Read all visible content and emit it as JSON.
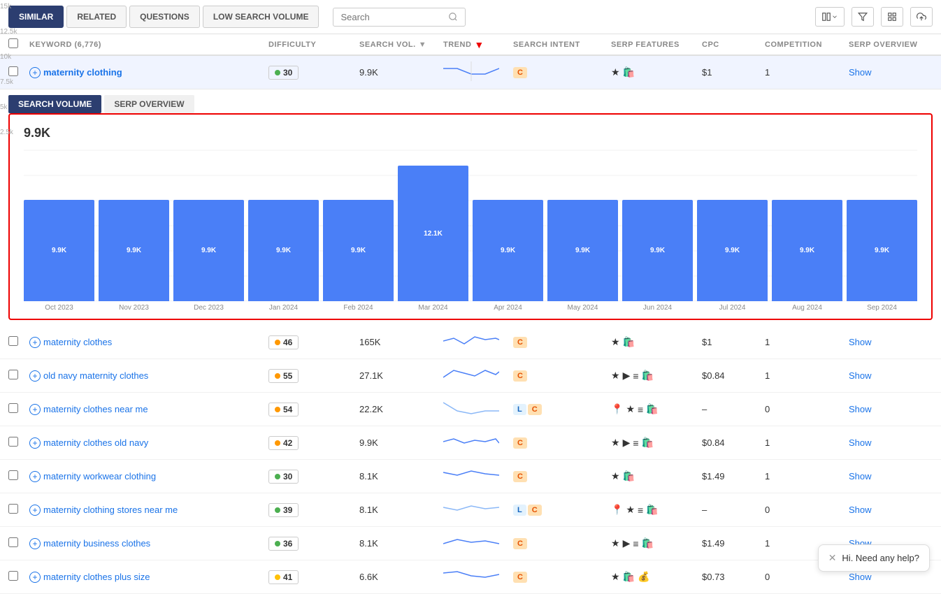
{
  "tabs": [
    {
      "id": "similar",
      "label": "SIMILAR",
      "active": true
    },
    {
      "id": "related",
      "label": "RELATED",
      "active": false
    },
    {
      "id": "questions",
      "label": "QUESTIONS",
      "active": false
    },
    {
      "id": "low_search_volume",
      "label": "LOW SEARCH VOLUME",
      "active": false
    }
  ],
  "search": {
    "placeholder": "Search"
  },
  "subtabs": [
    {
      "id": "search_volume",
      "label": "SEARCH VOLUME",
      "active": true
    },
    {
      "id": "serp_overview",
      "label": "SERP OVERVIEW",
      "active": false
    }
  ],
  "table": {
    "columns": {
      "keyword": "KEYWORD (6,776)",
      "difficulty": "DIFFICULTY",
      "search_vol": "SEARCH VOL.",
      "trend": "TREND",
      "search_intent": "SEARCH INTENT",
      "serp_features": "SERP FEATURES",
      "cpc": "CPC",
      "competition": "COMPETITION",
      "serp_overview": "SERP OVERVIEW"
    }
  },
  "main_keyword": {
    "name": "maternity clothing",
    "difficulty": 30,
    "diff_dot": "green",
    "search_vol": "9.9K",
    "intent": "C",
    "cpc": "$1",
    "competition": "1",
    "serp_overview": "Show"
  },
  "chart": {
    "title": "9.9K",
    "bars": [
      {
        "month": "Oct 2023",
        "value": "9.9K",
        "height_pct": 66
      },
      {
        "month": "Nov 2023",
        "value": "9.9K",
        "height_pct": 66
      },
      {
        "month": "Dec 2023",
        "value": "9.9K",
        "height_pct": 66
      },
      {
        "month": "Jan 2024",
        "value": "9.9K",
        "height_pct": 66
      },
      {
        "month": "Feb 2024",
        "value": "9.9K",
        "height_pct": 66
      },
      {
        "month": "Mar 2024",
        "value": "12.1K",
        "height_pct": 88
      },
      {
        "month": "Apr 2024",
        "value": "9.9K",
        "height_pct": 66
      },
      {
        "month": "May 2024",
        "value": "9.9K",
        "height_pct": 66
      },
      {
        "month": "Jun 2024",
        "value": "9.9K",
        "height_pct": 66
      },
      {
        "month": "Jul 2024",
        "value": "9.9K",
        "height_pct": 66
      },
      {
        "month": "Aug 2024",
        "value": "9.9K",
        "height_pct": 66
      },
      {
        "month": "Sep 2024",
        "value": "9.9K",
        "height_pct": 66
      }
    ],
    "y_ticks": [
      "15k",
      "12.5k",
      "10k",
      "7.5k",
      "5k",
      "2.5k",
      ""
    ]
  },
  "rows": [
    {
      "keyword": "maternity clothes",
      "difficulty": 46,
      "diff_dot": "orange",
      "search_vol": "165K",
      "intent": "C",
      "intent_l": false,
      "cpc": "$1",
      "competition": "1",
      "serp_overview": "Show",
      "serp_icons": "★🛍️"
    },
    {
      "keyword": "old navy maternity clothes",
      "difficulty": 55,
      "diff_dot": "orange",
      "search_vol": "27.1K",
      "intent": "C",
      "intent_l": false,
      "cpc": "$0.84",
      "competition": "1",
      "serp_overview": "Show",
      "serp_icons": "★▶≡🛍️"
    },
    {
      "keyword": "maternity clothes near me",
      "difficulty": 54,
      "diff_dot": "orange",
      "search_vol": "22.2K",
      "intent": "C",
      "intent_l": true,
      "cpc": "–",
      "competition": "0",
      "serp_overview": "Show",
      "serp_icons": "📍★≡🛍️"
    },
    {
      "keyword": "maternity clothes old navy",
      "difficulty": 42,
      "diff_dot": "orange",
      "search_vol": "9.9K",
      "intent": "C",
      "intent_l": false,
      "cpc": "$0.84",
      "competition": "1",
      "serp_overview": "Show",
      "serp_icons": "★▶≡🛍️"
    },
    {
      "keyword": "maternity workwear clothing",
      "difficulty": 30,
      "diff_dot": "green",
      "search_vol": "8.1K",
      "intent": "C",
      "intent_l": false,
      "cpc": "$1.49",
      "competition": "1",
      "serp_overview": "Show",
      "serp_icons": "★🛍️"
    },
    {
      "keyword": "maternity clothing stores near me",
      "difficulty": 39,
      "diff_dot": "green",
      "search_vol": "8.1K",
      "intent": "C",
      "intent_l": true,
      "cpc": "–",
      "competition": "0",
      "serp_overview": "Show",
      "serp_icons": "📍★≡🛍️"
    },
    {
      "keyword": "maternity business clothes",
      "difficulty": 36,
      "diff_dot": "green",
      "search_vol": "8.1K",
      "intent": "C",
      "intent_l": false,
      "cpc": "$1.49",
      "competition": "1",
      "serp_overview": "Show",
      "serp_icons": "★▶≡🛍️"
    },
    {
      "keyword": "maternity clothes plus size",
      "difficulty": 41,
      "diff_dot": "yellow",
      "search_vol": "6.6K",
      "intent": "C",
      "intent_l": false,
      "cpc": "$0.73",
      "competition": "0",
      "serp_overview": "Show",
      "serp_icons": "★💰🛍️"
    }
  ],
  "chat": {
    "message": "Hi. Need any help?"
  }
}
